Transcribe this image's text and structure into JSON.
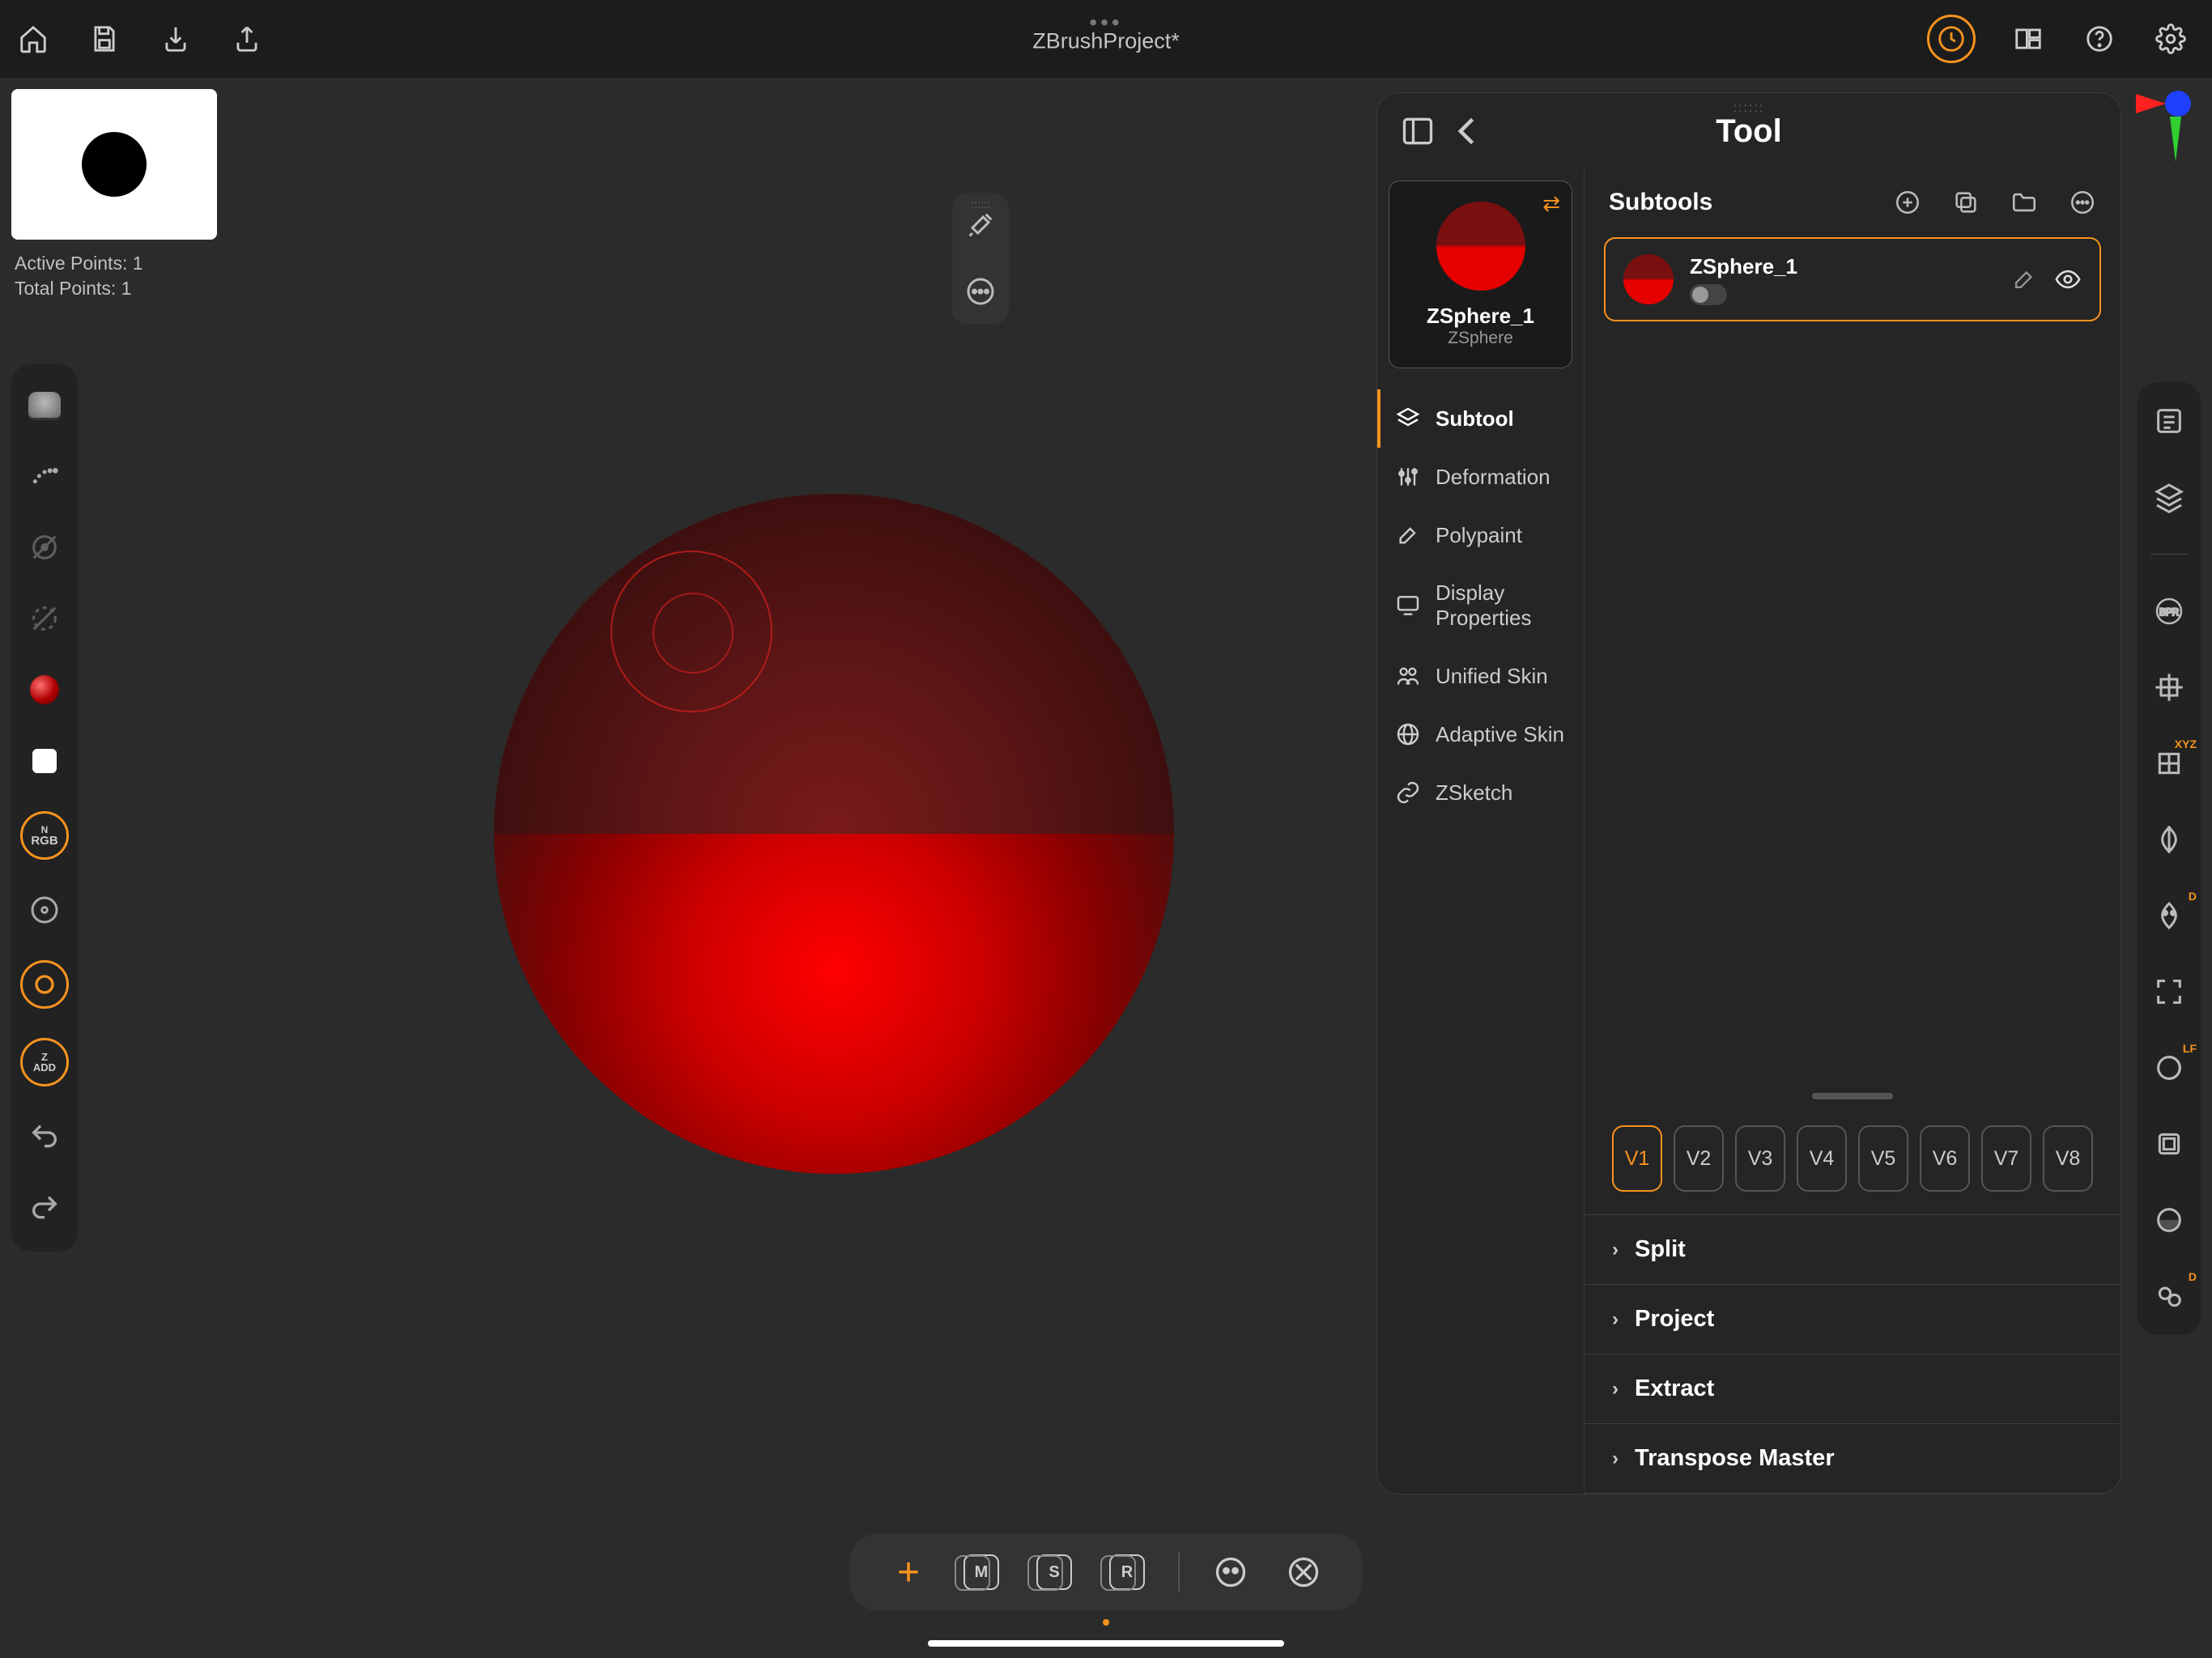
{
  "project_title": "ZBrushProject*",
  "preview": {
    "active_points": "Active Points: 1",
    "total_points": "Total Points: 1"
  },
  "left_strip": {
    "rgb_label": "RGB",
    "zadd_label": "ADD",
    "zadd_z": "Z",
    "rgb_n": "N"
  },
  "tool_panel": {
    "title": "Tool",
    "current_tool": {
      "name": "ZSphere_1",
      "type": "ZSphere"
    },
    "menu": [
      "Subtool",
      "Deformation",
      "Polypaint",
      "Display Properties",
      "Unified Skin",
      "Adaptive Skin",
      "ZSketch"
    ],
    "active_menu_index": 0,
    "subtools_title": "Subtools",
    "subtools": [
      {
        "name": "ZSphere_1"
      }
    ],
    "views": [
      "V1",
      "V2",
      "V3",
      "V4",
      "V5",
      "V6",
      "V7",
      "V8"
    ],
    "active_view_index": 0,
    "accordion": [
      "Split",
      "Project",
      "Extract",
      "Transpose Master"
    ]
  },
  "right_badges": {
    "xyz": "XYZ",
    "d": "D",
    "lf": "LF"
  },
  "bottom": {
    "m": "M",
    "s": "S",
    "r": "R"
  }
}
